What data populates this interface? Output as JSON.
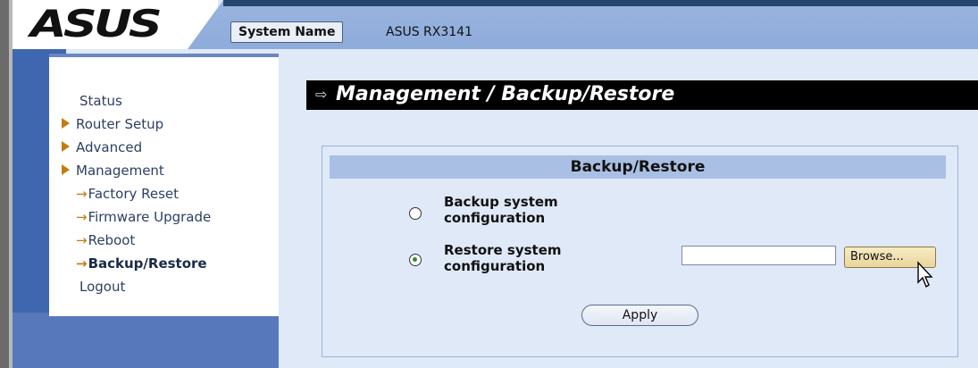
{
  "brand": {
    "logo_text": "ASUS"
  },
  "header": {
    "system_name_label": "System Name",
    "system_name_value": "ASUS RX3141"
  },
  "sidebar": {
    "items": [
      {
        "label": "Status",
        "arrow": false
      },
      {
        "label": "Router Setup",
        "arrow": true
      },
      {
        "label": "Advanced",
        "arrow": true
      },
      {
        "label": "Management",
        "arrow": true
      }
    ],
    "subitems": [
      {
        "label": "Factory Reset"
      },
      {
        "label": "Firmware Upgrade"
      },
      {
        "label": "Reboot"
      },
      {
        "label": "Backup/Restore",
        "active": true
      }
    ],
    "sub_arrow": "→",
    "logout": "Logout"
  },
  "main": {
    "title": "Management / Backup/Restore",
    "panel_title": "Backup/Restore",
    "options": [
      {
        "label_line1": "Backup system",
        "label_line2": "configuration",
        "selected": false
      },
      {
        "label_line1": "Restore system",
        "label_line2": "configuration",
        "selected": true
      }
    ],
    "file_input_value": "",
    "browse_label": "Browse...",
    "apply_label": "Apply"
  },
  "colors": {
    "header_band": "#9ab4df",
    "title_bar": "#000000",
    "panel_header": "#a9bfe3",
    "menu_arrow": "#c77a0b"
  }
}
